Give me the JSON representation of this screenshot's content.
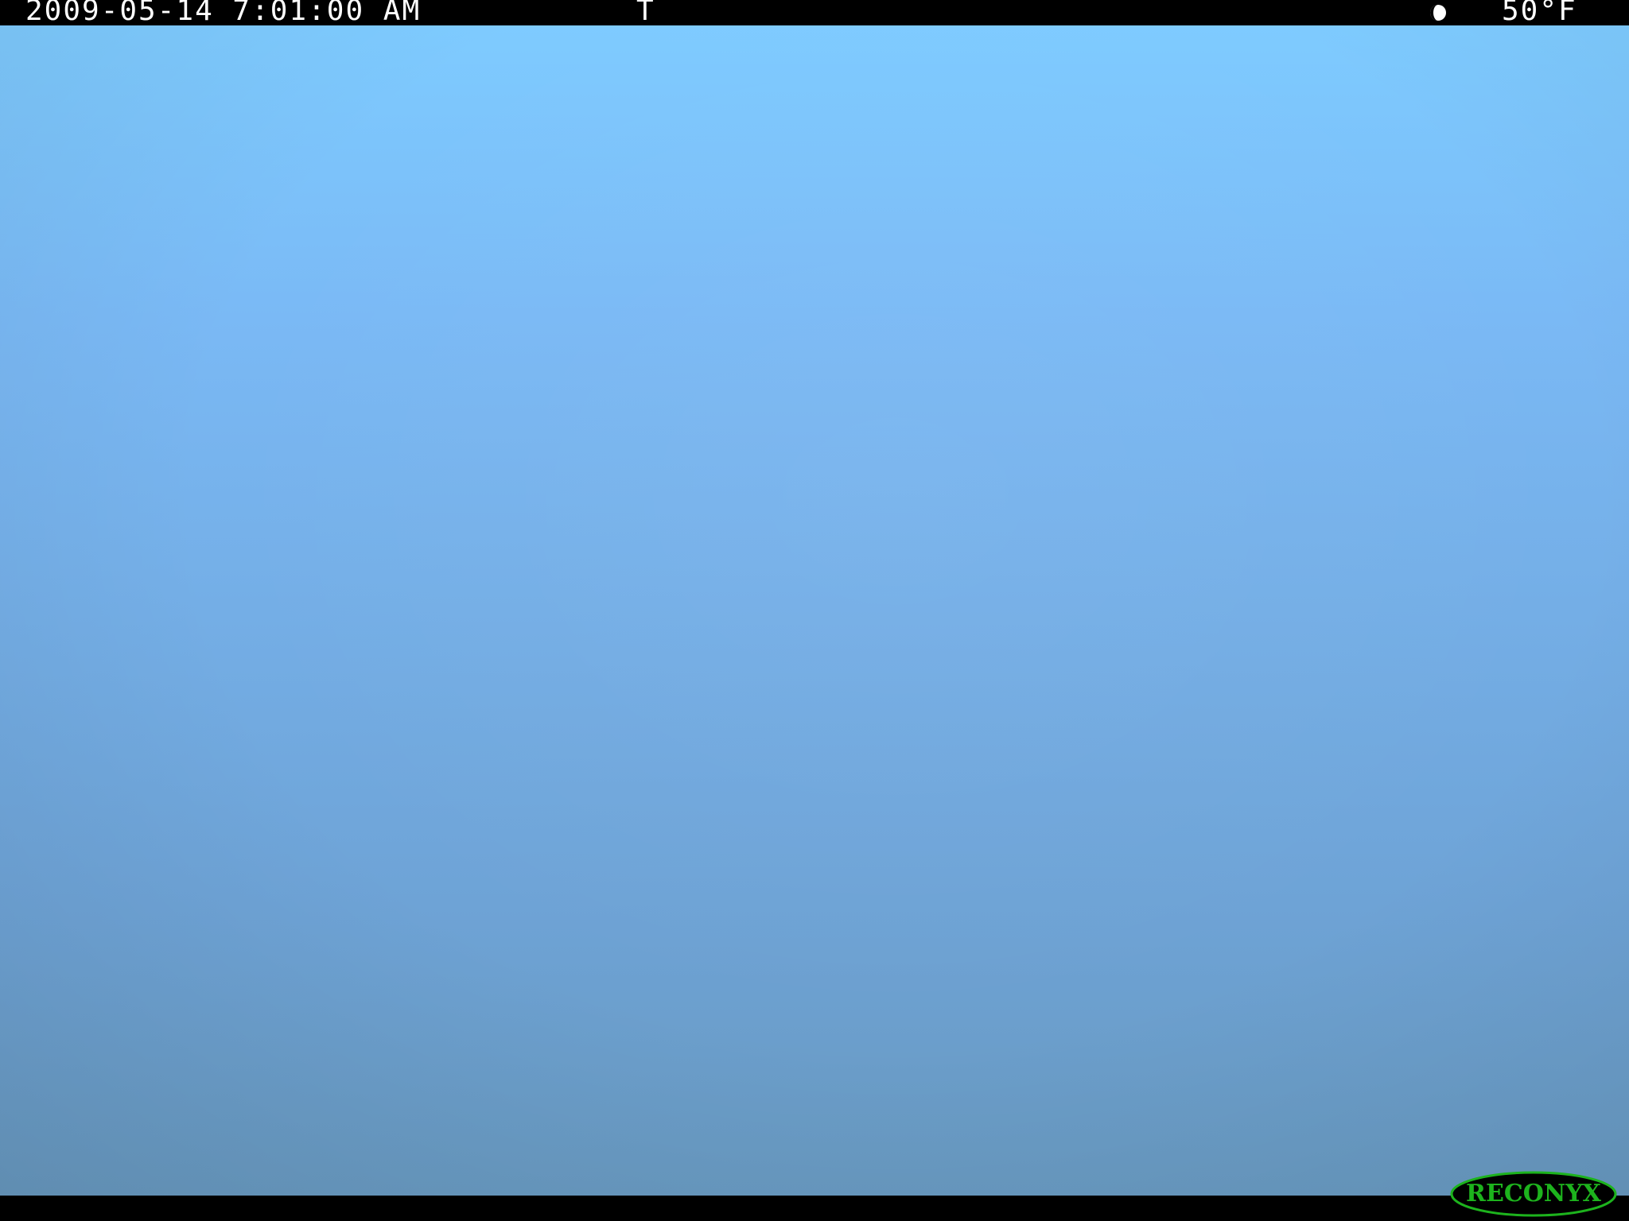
{
  "info_bar": {
    "timestamp": "2009-05-14 7:01:00 AM",
    "trigger_mode": "T",
    "moon_phase_icon": "moon-phase-icon",
    "temperature": "50°F"
  },
  "photo": {
    "subject": "",
    "sky_color_top": "#7ecbff",
    "sky_color_bottom": "#6899c0"
  },
  "logo": {
    "brand": "RECONYX",
    "color": "#1db31d"
  }
}
